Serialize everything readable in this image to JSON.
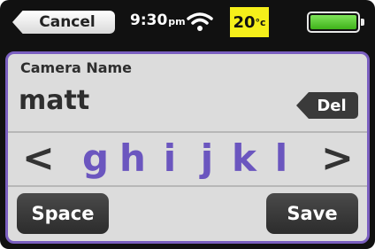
{
  "status_bar": {
    "cancel_label": "Cancel",
    "time": "9:30",
    "time_suffix": "pm",
    "temperature": "20",
    "temperature_unit": "°c",
    "battery_level": 1.0,
    "temp_bg_color": "#f5ef1a",
    "battery_color": "#4fc42a"
  },
  "editor": {
    "field_label": "Camera Name",
    "value": "matt",
    "delete_label": "Del",
    "accent_color": "#7a5fc0"
  },
  "letter_picker": {
    "prev_symbol": "<",
    "letters": [
      "g",
      "h",
      "i",
      "j",
      "k",
      "l"
    ],
    "next_symbol": ">",
    "letter_color": "#6b56bf"
  },
  "actions": {
    "space_label": "Space",
    "save_label": "Save"
  }
}
